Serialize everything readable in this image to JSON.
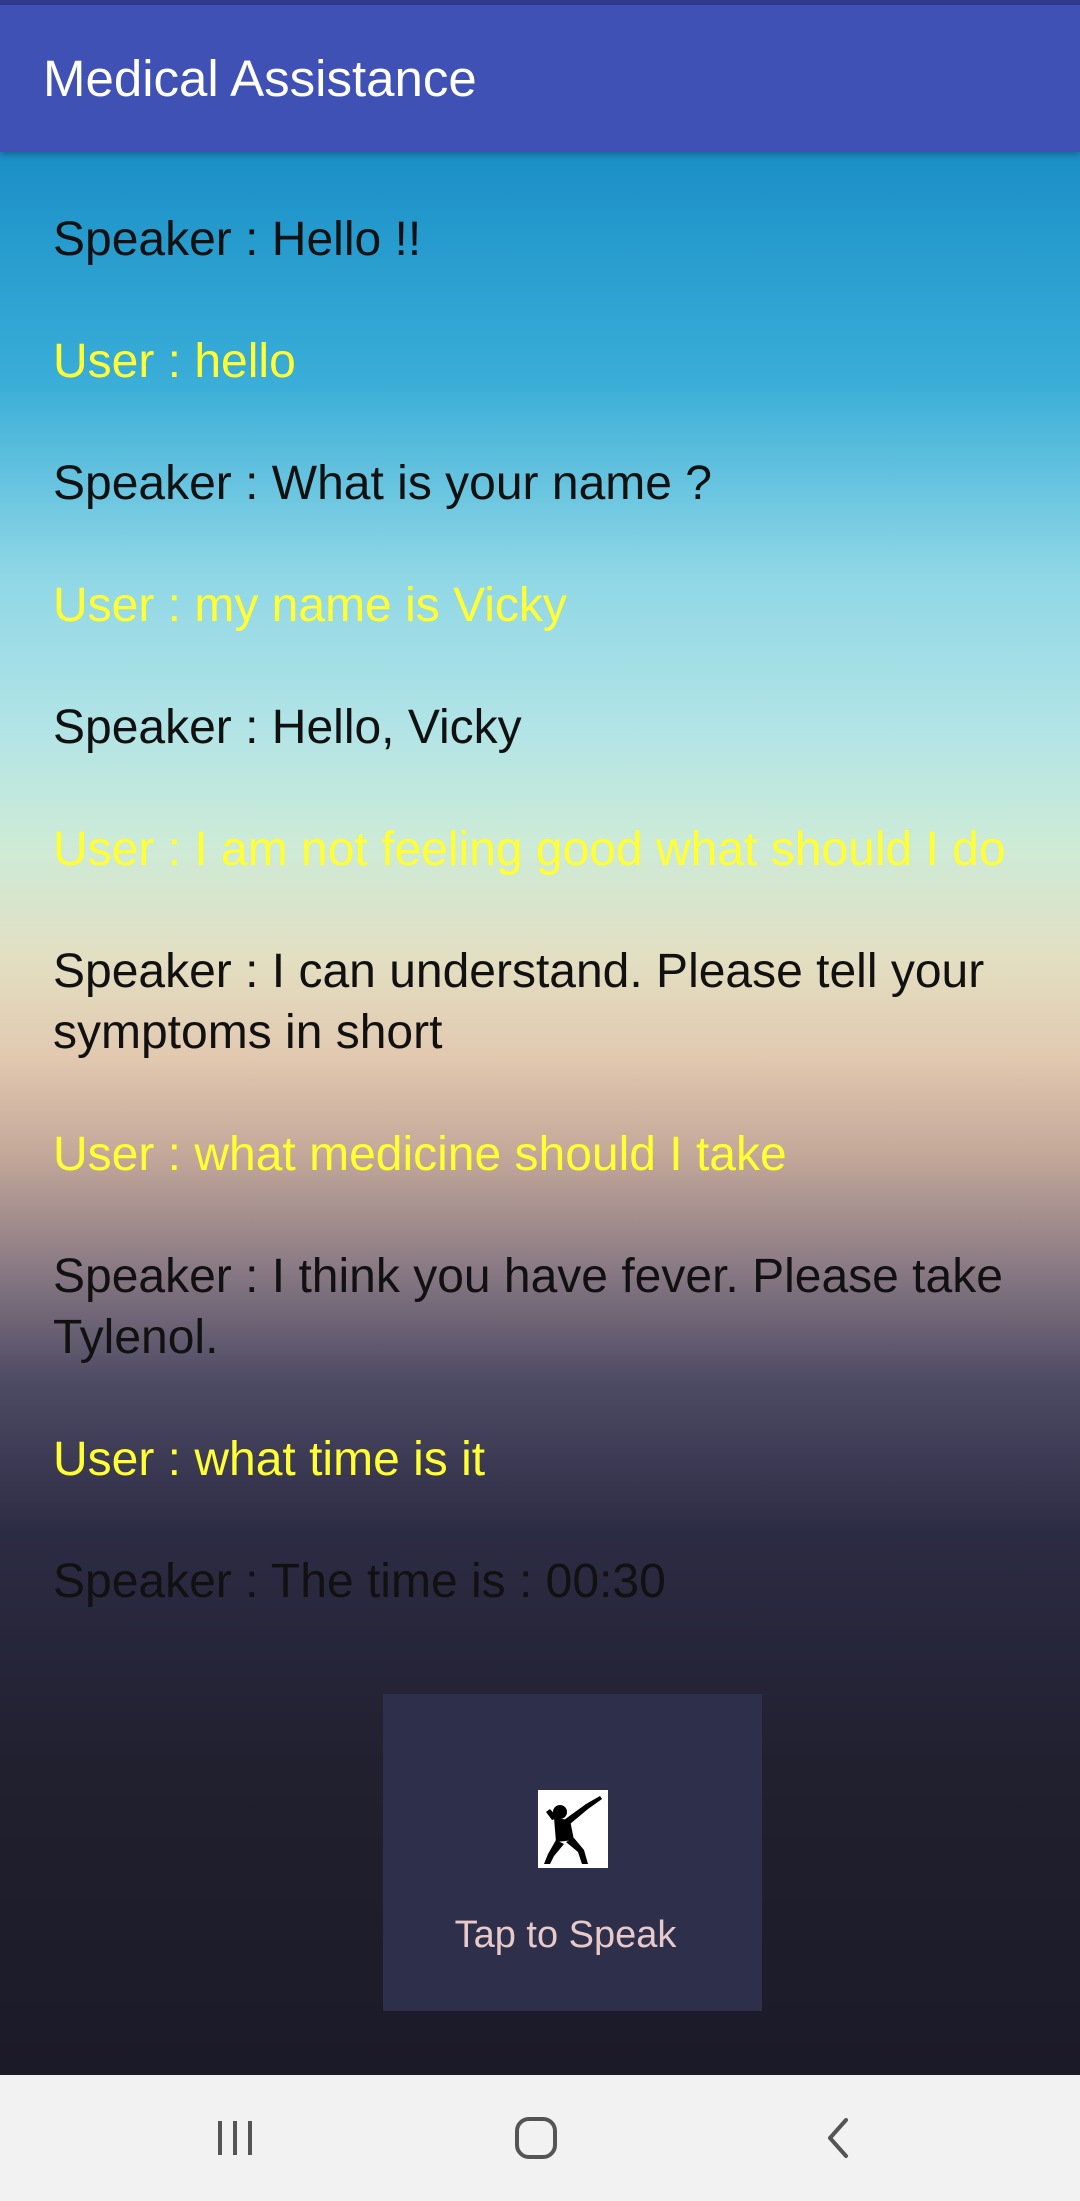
{
  "app": {
    "title": "Medical Assistance"
  },
  "conversation": [
    {
      "role": "speaker",
      "text": "Speaker : Hello !!"
    },
    {
      "role": "user",
      "text": "User : hello"
    },
    {
      "role": "speaker",
      "text": "Speaker : What is your name ?"
    },
    {
      "role": "user",
      "text": "User : my name is Vicky"
    },
    {
      "role": "speaker",
      "text": "Speaker : Hello, Vicky"
    },
    {
      "role": "user",
      "text": "User : I am not feeling good what should I do"
    },
    {
      "role": "speaker",
      "text": "Speaker : I can understand. Please tell your symptoms in short"
    },
    {
      "role": "user",
      "text": "User : what medicine should I take"
    },
    {
      "role": "speaker",
      "text": "Speaker : I think you have fever. Please take Tylenol."
    },
    {
      "role": "user",
      "text": "User : what time is it"
    },
    {
      "role": "speaker",
      "text": "Speaker : The time is : 00:30"
    }
  ],
  "speak_button": {
    "label": "Tap to Speak",
    "icon": "dab-figure-icon"
  },
  "nav": {
    "recents_icon": "recents-icon",
    "home_icon": "home-icon",
    "back_icon": "back-icon"
  },
  "colors": {
    "app_bar": "#3f51b5",
    "speaker_text": "#111111",
    "user_text": "#ffff33",
    "speak_panel": "#2d2f4b",
    "speak_label": "#e8c9c9"
  }
}
